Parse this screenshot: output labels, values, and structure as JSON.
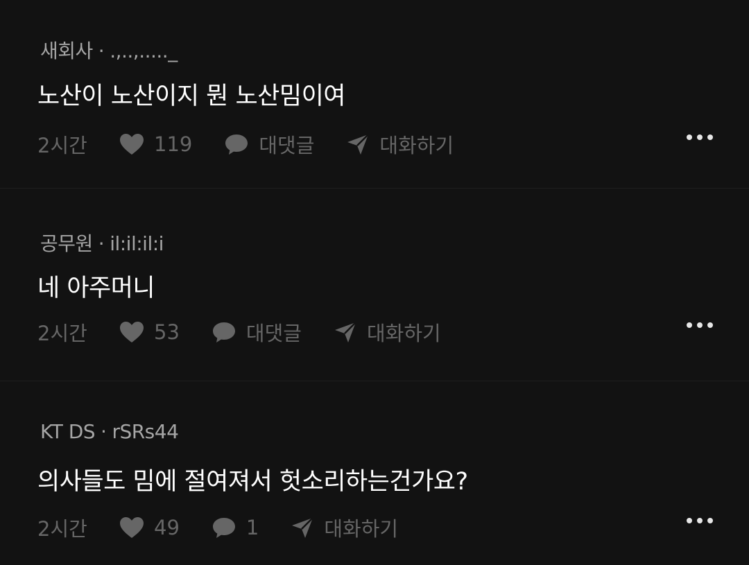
{
  "comments": [
    {
      "company": "새회사",
      "separator": "·",
      "nickname": ".,..,....._",
      "text": "노산이 노산이지 뭔 노산밈이여",
      "time": "2시간",
      "likes": "119",
      "reply_label": "대댓글",
      "chat_label": "대화하기"
    },
    {
      "company": "공무원",
      "separator": "·",
      "nickname": "il:il:il:i",
      "text": "네 아주머니",
      "time": "2시간",
      "likes": "53",
      "reply_label": "대댓글",
      "chat_label": "대화하기"
    },
    {
      "company": "KT DS",
      "separator": "·",
      "nickname": "rSRs44",
      "text": "의사들도 밈에 절여져서 헛소리하는건가요?",
      "time": "2시간",
      "likes": "49",
      "reply_label": "1",
      "chat_label": "대화하기"
    }
  ],
  "icons": {
    "like": "heart-icon",
    "reply": "speech-bubble-icon",
    "chat": "paper-plane-icon",
    "more": "more-horizontal-icon"
  },
  "colors": {
    "background": "#121212",
    "text": "#ffffff",
    "meta": "#a6a6a6",
    "muted": "#666666"
  }
}
